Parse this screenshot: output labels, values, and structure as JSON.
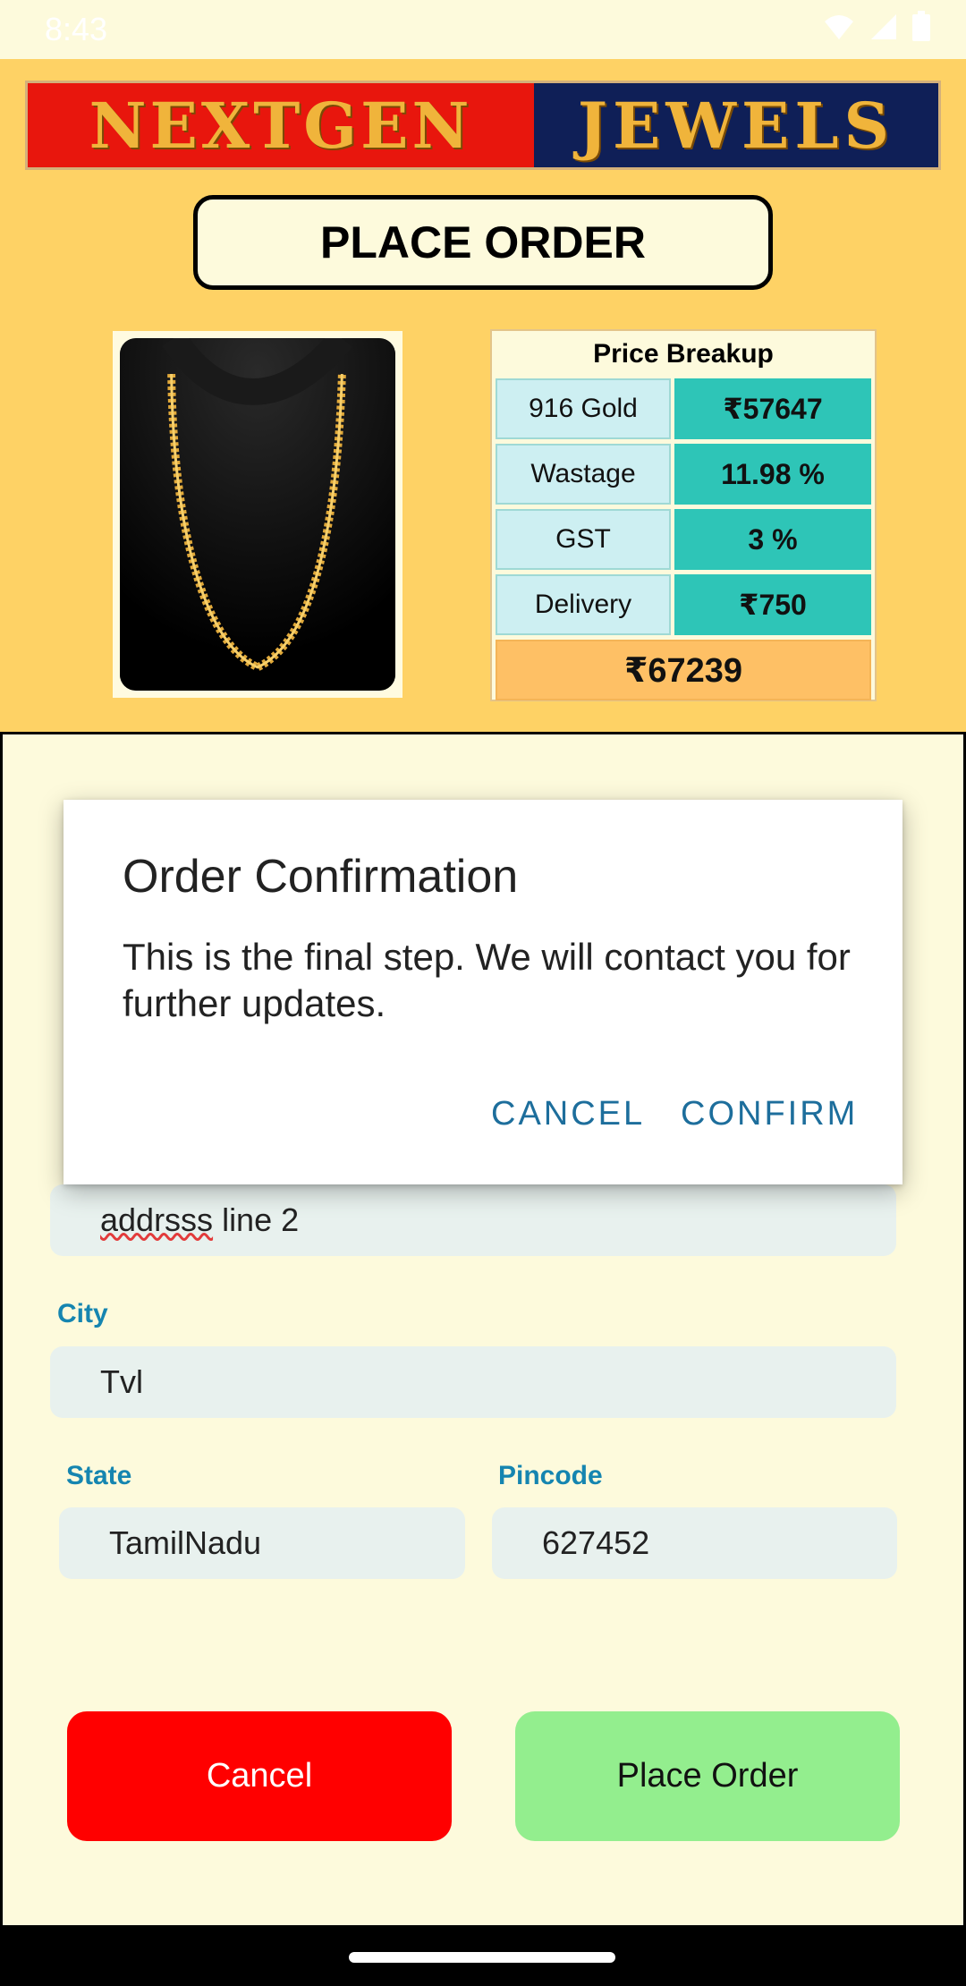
{
  "status_bar": {
    "time": "8:43",
    "icons": [
      "a-badge-icon",
      "sim-alert-icon",
      "wifi-icon",
      "signal-icon",
      "battery-icon"
    ]
  },
  "logo": {
    "left_text": "NEXTGEN",
    "right_text": "JEWELS"
  },
  "page": {
    "title": "PLACE ORDER"
  },
  "price_breakup": {
    "header": "Price Breakup",
    "rows": [
      {
        "label": "916 Gold",
        "value": "₹57647"
      },
      {
        "label": "Wastage",
        "value": "11.98 %"
      },
      {
        "label": "GST",
        "value": "3 %"
      },
      {
        "label": "Delivery",
        "value": "₹750"
      }
    ],
    "total": "₹67239"
  },
  "form": {
    "address2_value": "addrsss line 2",
    "city_label": "City",
    "city_value": "Tvl",
    "state_label": "State",
    "state_value": "TamilNadu",
    "pincode_label": "Pincode",
    "pincode_value": "627452"
  },
  "buttons": {
    "cancel": "Cancel",
    "place_order": "Place Order"
  },
  "dialog": {
    "title": "Order Confirmation",
    "message": "This is the final step. We will contact you for further updates.",
    "cancel": "CANCEL",
    "confirm": "CONFIRM"
  },
  "colors": {
    "header_bg": "#fed265",
    "form_bg": "#fdfadc",
    "label_blue": "#1585b0",
    "cancel_red": "#ff0000",
    "place_green": "#93ee8e",
    "price_teal": "#2ec5b7",
    "total_orange": "#fec065"
  }
}
